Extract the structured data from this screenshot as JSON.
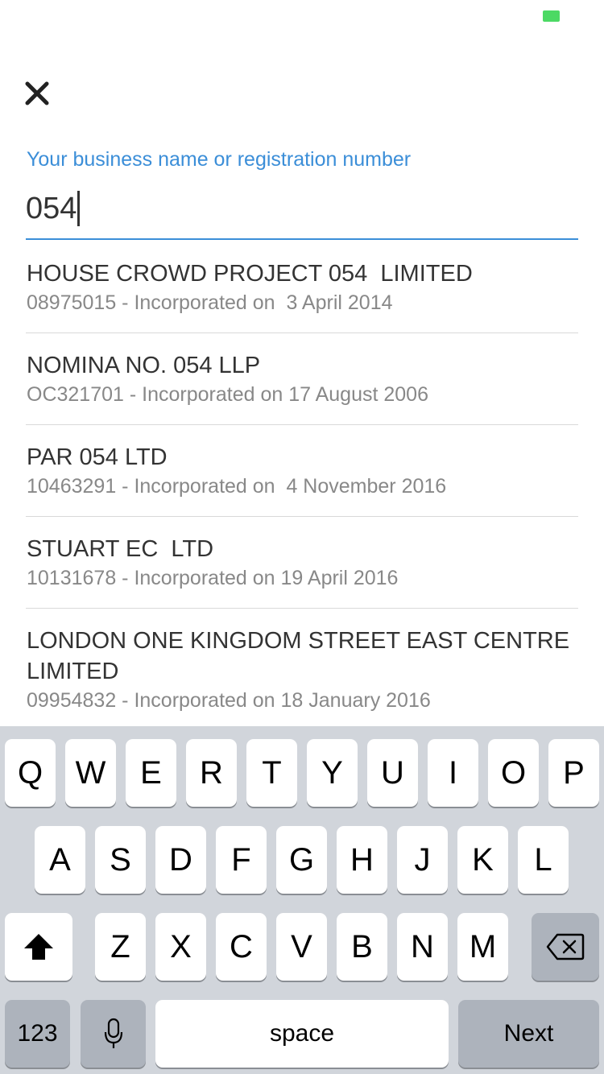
{
  "status_bar": {
    "battery_color": "#4cd964"
  },
  "header": {
    "close_icon": "close-icon"
  },
  "search": {
    "label": "Your business name or registration number",
    "value": "054",
    "accent_color": "#3b8ed8"
  },
  "results": [
    {
      "name": "HOUSE CROWD PROJECT 054  LIMITED",
      "detail": "08975015 - Incorporated on  3 April 2014"
    },
    {
      "name": "NOMINA NO. 054 LLP",
      "detail": "OC321701 - Incorporated on 17 August 2006"
    },
    {
      "name": "PAR 054 LTD",
      "detail": "10463291 - Incorporated on  4 November 2016"
    },
    {
      "name": "STUART EC  LTD",
      "detail": "10131678 - Incorporated on 19 April 2016"
    },
    {
      "name": "LONDON ONE KINGDOM STREET EAST CENTRE LIMITED",
      "detail": "09954832 - Incorporated on 18 January 2016"
    }
  ],
  "keyboard": {
    "row1": [
      "Q",
      "W",
      "E",
      "R",
      "T",
      "Y",
      "U",
      "I",
      "O",
      "P"
    ],
    "row2": [
      "A",
      "S",
      "D",
      "F",
      "G",
      "H",
      "J",
      "K",
      "L"
    ],
    "row3": [
      "Z",
      "X",
      "C",
      "V",
      "B",
      "N",
      "M"
    ],
    "shift_icon": "shift-icon",
    "backspace_icon": "backspace-icon",
    "mic_icon": "microphone-icon",
    "numbers_label": "123",
    "space_label": "space",
    "next_label": "Next"
  }
}
